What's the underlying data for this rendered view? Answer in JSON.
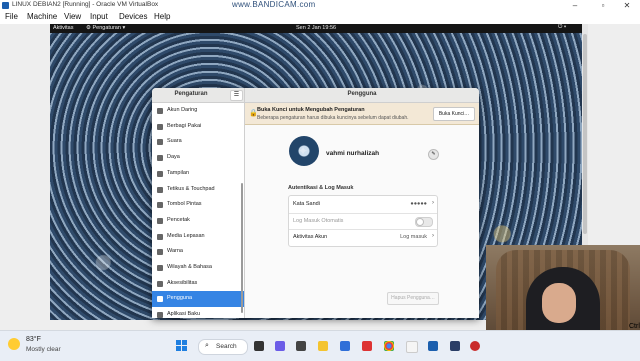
{
  "vbox": {
    "title": "LINUX DEBIAN2 [Running] - Oracle VM VirtualBox",
    "watermark": "www.BANDICAM.com",
    "menu": [
      "File",
      "Machine",
      "View",
      "Input",
      "Devices",
      "Help"
    ]
  },
  "gnome": {
    "activities": "Aktivitas",
    "app_menu": "Pengaturan",
    "clock": "Sen 2 Jan 19:56"
  },
  "settings": {
    "sidebar_title": "Pengaturan",
    "main_title": "Pengguna",
    "sidebar_items": [
      {
        "label": "Akun Daring",
        "icon": "cloud-icon",
        "active": false
      },
      {
        "label": "Berbagi Pakai",
        "icon": "share-icon",
        "active": false
      },
      {
        "label": "Suara",
        "icon": "speaker-icon",
        "active": false
      },
      {
        "label": "Daya",
        "icon": "power-icon",
        "active": false
      },
      {
        "label": "Tampilan",
        "icon": "display-icon",
        "active": false
      },
      {
        "label": "Tetikus & Touchpad",
        "icon": "mouse-icon",
        "active": false
      },
      {
        "label": "Tombol Pintas",
        "icon": "keyboard-icon",
        "active": false
      },
      {
        "label": "Pencetak",
        "icon": "printer-icon",
        "active": false
      },
      {
        "label": "Media Lepasan",
        "icon": "media-icon",
        "active": false
      },
      {
        "label": "Warna",
        "icon": "color-icon",
        "active": false
      },
      {
        "label": "Wilayah & Bahasa",
        "icon": "globe-icon",
        "active": false
      },
      {
        "label": "Aksesibilitas",
        "icon": "accessibility-icon",
        "active": false
      },
      {
        "label": "Pengguna",
        "icon": "users-icon",
        "active": true
      },
      {
        "label": "Aplikasi Baku",
        "icon": "star-icon",
        "active": false
      }
    ],
    "unlock": {
      "title": "Buka Kunci untuk Mengubah Pengaturan",
      "subtitle": "Beberapa pengaturan harus dibuka kuncinya sebelum dapat diubah.",
      "button": "Buka Kunci…"
    },
    "user_name": "vahmi nurhalizah",
    "auth_heading": "Autentikasi & Log Masuk",
    "rows": [
      {
        "key": "Kata Sandi",
        "value": "●●●●●"
      },
      {
        "key": "Log Masuk Otomatis",
        "value": ""
      },
      {
        "key": "Aktivitas Akun",
        "value": "Log masuk"
      }
    ],
    "auto_login_on": false,
    "remove_button": "Hapus Pengguna…"
  },
  "overlay": {
    "ctrl_text": "Ctrl"
  },
  "taskbar": {
    "weather_temp": "83°F",
    "weather_desc": "Mostly clear",
    "search_label": "Search"
  },
  "colors": {
    "accent": "#3584e4",
    "banner": "#f3e8d6"
  }
}
